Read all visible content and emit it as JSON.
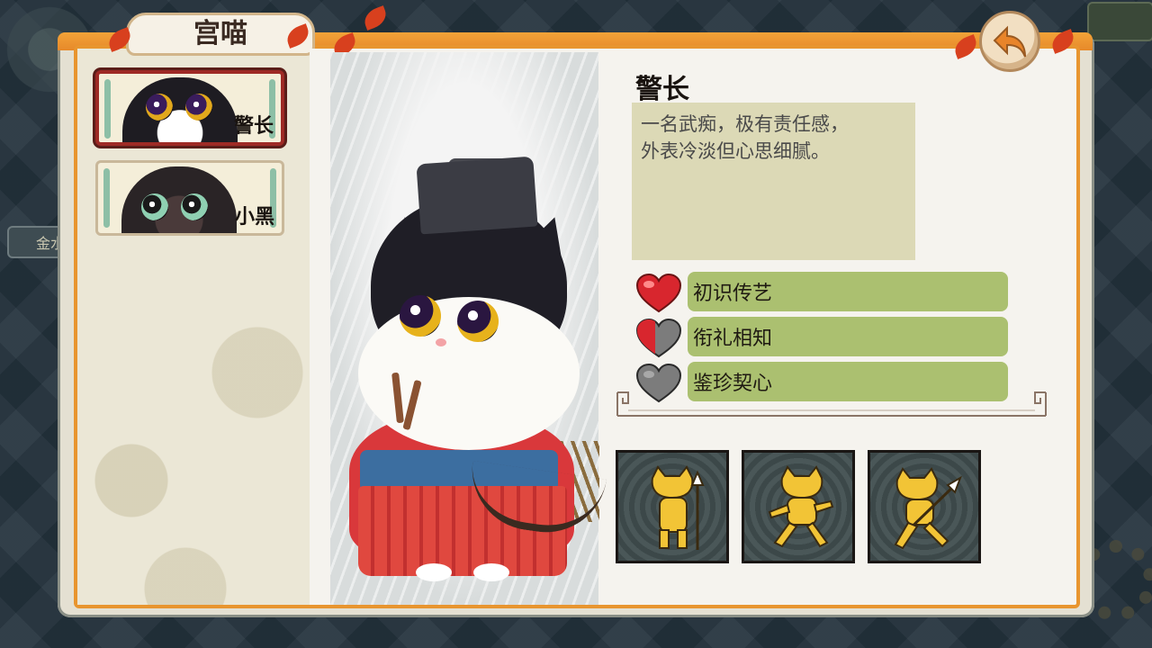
{
  "window": {
    "title": "宫喵"
  },
  "background": {
    "left_tag": "金水"
  },
  "characters": [
    {
      "label": "警长",
      "selected": true
    },
    {
      "label": "小黑",
      "selected": false
    }
  ],
  "detail": {
    "name": "警长",
    "description_lines": [
      "一名武痴，极有责任感，",
      "外表冷淡但心思细腻。"
    ]
  },
  "relationships": [
    {
      "label": "初识传艺",
      "heart": "full"
    },
    {
      "label": "衔礼相知",
      "heart": "half"
    },
    {
      "label": "鉴珍契心",
      "heart": "empty"
    }
  ],
  "skills": [
    {
      "icon": "cat-spear-pose-icon"
    },
    {
      "icon": "cat-stance-pose-icon"
    },
    {
      "icon": "cat-lunge-pose-icon"
    }
  ],
  "colors": {
    "panel_border": "#e8952f",
    "relation_bar": "#abc070",
    "heart_red": "#d8262e",
    "heart_gray": "#7c7c7c",
    "selected_card": "#9e2a25"
  }
}
